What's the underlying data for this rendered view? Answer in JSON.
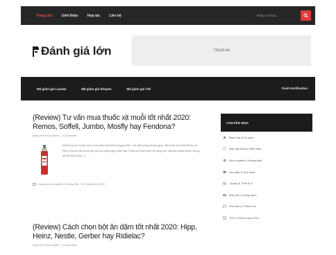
{
  "topnav": {
    "items": [
      "Trang chủ",
      "Giới thiệu",
      "Hợp tác",
      "Liên hệ"
    ],
    "active_index": 0,
    "search_placeholder": "Nhập từ khóa..."
  },
  "header": {
    "logo_text": "Đánh giá lớn",
    "ad_text": "728x90 Ad"
  },
  "mainnav": {
    "items": [
      "Mã giảm giá Lazada",
      "Mã giảm giá Shopee",
      "Mã giảm giá Tiki"
    ],
    "push": "Push Notification"
  },
  "posts": [
    {
      "title": "(Review) Tư vấn mua thuốc xịt muỗi tốt nhất 2020: Remos, Soffell, Jumbo, Mosfly hay Fendona?",
      "author": "Đăng bởi Vũ Đức Mạnh",
      "comments": "0 Comments",
      "excerpt": "Muỗi là vector truyền bệnh của nhiều loại bệnh lý nguy hiểm. Các biện pháp phòng ngừa, diệt muỗi cần thiết để bảo vệ nhà ở khỏi sự tấn công của loại côn trùng nguy hiểm này. Thuốc xịt muỗi được sử dụng như một biện pháp nhanh chóng để tiêu diệt muỗi [...]",
      "category": "Category: Kinh nghiệm & Hướng dẫn",
      "date": "31 Tháng Mười, 2020"
    },
    {
      "title": "(Review) Cách chọn bột ăn dặm tốt nhất 2020: Hipp, Heinz, Nestle, Gerber hay Ridielac?",
      "author": "Đăng bởi Vũ Đức Mạnh",
      "comments": "0 Comments"
    }
  ],
  "sidebar": {
    "heading": "CHUYÊN MỤC",
    "items": [
      "Đánh giá & So sánh",
      "Điện gia dụng & Điện lạnh",
      "Kinh nghiệm & Hướng dẫn",
      "Làm đẹp & Sức khỏe",
      "Laptop & Thiết bị IT",
      "Máy ảnh & Quay phim",
      "Phụ kiện & Thiết bị số",
      "Tivi & Thiết bị nghe nhìn"
    ]
  },
  "colors": {
    "topbar_bg": "#262626",
    "mainnav_bg": "#1c1c1c",
    "accent_red": "#e23a3a",
    "active_link": "#e2504b"
  }
}
